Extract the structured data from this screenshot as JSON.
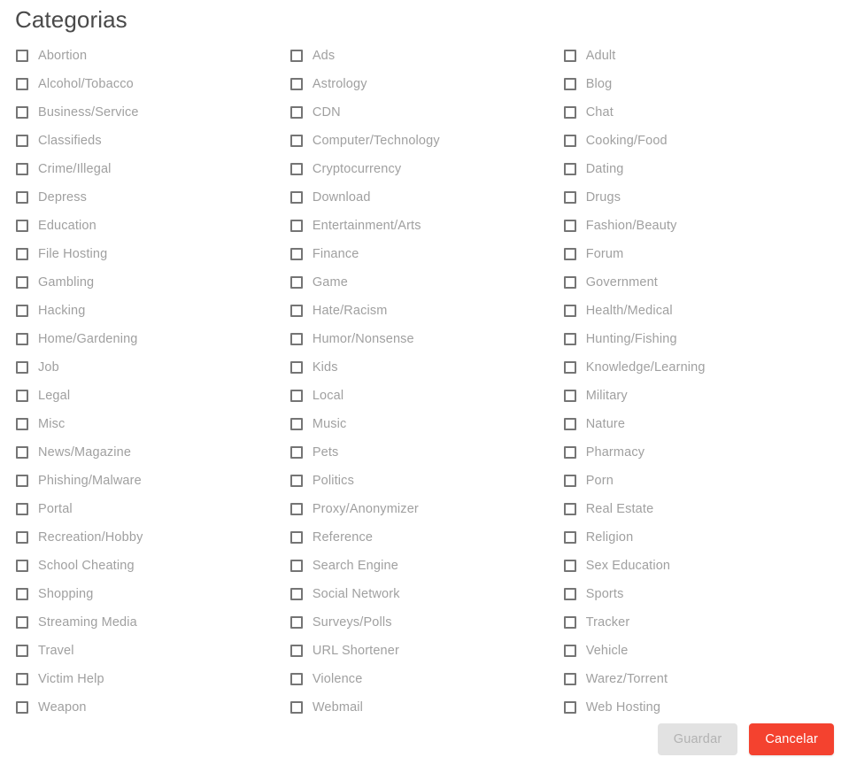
{
  "page": {
    "title": "Categorias"
  },
  "columns": [
    {
      "items": [
        "Abortion",
        "Alcohol/Tobacco",
        "Business/Service",
        "Classifieds",
        "Crime/Illegal",
        "Depress",
        "Education",
        "File Hosting",
        "Gambling",
        "Hacking",
        "Home/Gardening",
        "Job",
        "Legal",
        "Misc",
        "News/Magazine",
        "Phishing/Malware",
        "Portal",
        "Recreation/Hobby",
        "School Cheating",
        "Shopping",
        "Streaming Media",
        "Travel",
        "Victim Help",
        "Weapon"
      ]
    },
    {
      "items": [
        "Ads",
        "Astrology",
        "CDN",
        "Computer/Technology",
        "Cryptocurrency",
        "Download",
        "Entertainment/Arts",
        "Finance",
        "Game",
        "Hate/Racism",
        "Humor/Nonsense",
        "Kids",
        "Local",
        "Music",
        "Pets",
        "Politics",
        "Proxy/Anonymizer",
        "Reference",
        "Search Engine",
        "Social Network",
        "Surveys/Polls",
        "URL Shortener",
        "Violence",
        "Webmail"
      ]
    },
    {
      "items": [
        "Adult",
        "Blog",
        "Chat",
        "Cooking/Food",
        "Dating",
        "Drugs",
        "Fashion/Beauty",
        "Forum",
        "Government",
        "Health/Medical",
        "Hunting/Fishing",
        "Knowledge/Learning",
        "Military",
        "Nature",
        "Pharmacy",
        "Porn",
        "Real Estate",
        "Religion",
        "Sex Education",
        "Sports",
        "Tracker",
        "Vehicle",
        "Warez/Torrent",
        "Web Hosting"
      ]
    }
  ],
  "actions": {
    "save_label": "Guardar",
    "save_disabled": true,
    "cancel_label": "Cancelar"
  },
  "colors": {
    "title_text": "#4a4a4a",
    "label_text": "#a0a0a0",
    "checkbox_border": "#757575",
    "cancel_button_bg": "#f4422f",
    "cancel_button_text": "#ffffff",
    "save_button_bg": "#e2e2e2",
    "save_button_text": "#b2b2b2",
    "page_bg": "#ffffff"
  }
}
